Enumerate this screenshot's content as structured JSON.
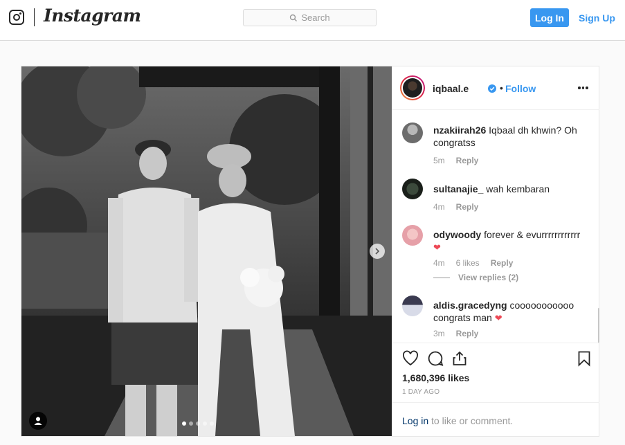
{
  "nav": {
    "brand": "Instagram",
    "search_placeholder": "Search",
    "login_label": "Log In",
    "signup_label": "Sign Up"
  },
  "post": {
    "username": "iqbaal.e",
    "follow_label": "Follow",
    "separator": "•",
    "carousel": {
      "total": 5,
      "active": 1
    },
    "comments": [
      {
        "user": "nzakiirah26",
        "text": "Iqbaal dh khwin? Oh congratss",
        "time": "5m",
        "likes": "",
        "reply": "Reply"
      },
      {
        "user": "sultanajie_",
        "text": "wah kembaran",
        "time": "4m",
        "likes": "",
        "reply": "Reply"
      },
      {
        "user": "odywoody",
        "text": "forever & evurrrrrrrrrrrr",
        "emoji": "❤",
        "time": "4m",
        "likes": "6 likes",
        "reply": "Reply",
        "view_replies": "View replies (2)"
      },
      {
        "user": "aldis.gracedyng",
        "text": "cooooooooooo congrats man",
        "emoji": "❤",
        "time": "3m",
        "likes": "",
        "reply": "Reply"
      }
    ],
    "likes_count": "1,680,396 likes",
    "time_ago": "1 DAY AGO",
    "login_prompt": {
      "link": "Log in",
      "text": " to like or comment."
    }
  },
  "colors": {
    "accent": "#3897f0",
    "heart": "#ed4956",
    "border": "#dbdbdb"
  }
}
